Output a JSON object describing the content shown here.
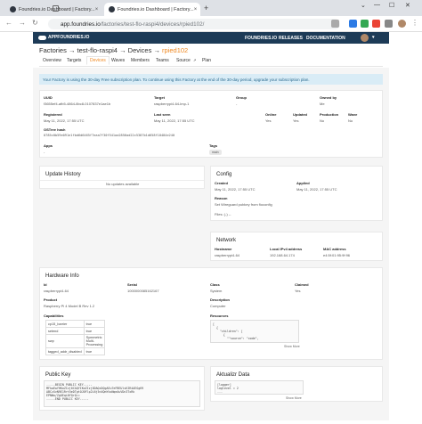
{
  "browser": {
    "tabs": [
      {
        "title": "Foundries.io Dashboard | Factory..."
      },
      {
        "title": "Foundries.io Dashboard | Factory..."
      }
    ],
    "url_host": "app.foundries.io",
    "url_path": "/factories/test-flo-raspi4/devices/rpied102/"
  },
  "app": {
    "logo": "APPFOUNDRIES.IO",
    "nav": [
      "FOUNDRIES.IO",
      "RELEASES",
      "DOCUMENTATION"
    ]
  },
  "breadcrumb": {
    "factories": "Factories",
    "factory": "test-flo-raspi4",
    "devices": "Devices",
    "device": "rpied102",
    "arrow": "→"
  },
  "subtabs": [
    "Overview",
    "Targets",
    "Devices",
    "Waves",
    "Members",
    "Teams",
    "Source",
    "Plan"
  ],
  "alert": "Your Factory is using the 30-day Free subscription plan. To continue using this Factory at the end of the 30-day period, upgrade your subscription plan.",
  "device": {
    "uuid_label": "UUID",
    "uuid": "f3655ef4-afb5-4864-8bc8-0107837e1ae1b",
    "target_label": "Target",
    "target": "raspberrypi4-64-lmp-1",
    "group_label": "Group",
    "group": "-",
    "owned_label": "Owned by",
    "owned": "Me",
    "registered_label": "Registered",
    "registered": "May 11, 2022, 17:55 UTC",
    "lastseen_label": "Last seen",
    "lastseen": "May 11, 2022, 17:55 UTC",
    "online_label": "Online",
    "online": "Yes",
    "updated_label": "Updated",
    "updated": "Yes",
    "production_label": "Production",
    "production": "No",
    "wave_label": "Wave",
    "wave": "No",
    "ostree_label": "OSTree hash",
    "ostree": "0785c0b59e091e1fbd6d6465f7eaa7f30f541aa2856ad22c5387b1d658f18484e240",
    "apps_label": "Apps",
    "apps": "-",
    "tags_label": "Tags",
    "tag": "main"
  },
  "update_history": {
    "title": "Update History",
    "empty": "No updates available"
  },
  "config": {
    "title": "Config",
    "created_label": "Created",
    "created": "May 11, 2022, 17:55 UTC",
    "applied_label": "Applied",
    "applied": "May 11, 2022, 17:55 UTC",
    "reason_label": "Reason",
    "reason": "Set Wireguard pubkey from fioconfig",
    "files_label": "Files: (-) --"
  },
  "network": {
    "title": "Network",
    "hostname_label": "Hostname",
    "hostname": "raspberrypi4-64",
    "ipv4_label": "Local IPv4 address",
    "ipv4": "192.168.64.174",
    "mac_label": "MAC address",
    "mac": "e4:5f:01:95:9f:96"
  },
  "hardware": {
    "title": "Hardware Info",
    "id_label": "Id",
    "id": "raspberrypi4-64",
    "serial_label": "Serial",
    "serial": "1000000085162167",
    "class_label": "Class",
    "class": "System",
    "claimed_label": "Claimed",
    "claimed": "Yes",
    "product_label": "Product",
    "product": "Raspberry Pi 4 Model B Rev 1.2",
    "desc_label": "Description",
    "desc": "Computer",
    "caps_label": "Capabilities",
    "capabilities": [
      [
        "cp15_barrier",
        "true"
      ],
      [
        "setend",
        "true"
      ],
      [
        "swp",
        "Symmetric Multi-Processing"
      ],
      [
        "tagged_addr_disabled",
        "true"
      ]
    ],
    "resources_label": "Resources",
    "resources_code": "[\n  {\n    \"children\": [\n      {\n        \"\"source\": \"code\",",
    "show_more": "Show More"
  },
  "public_key": {
    "title": "Public Key",
    "code": "-----BEGIN PUBLIC KEY-----\nMFkwEwYHKoZIzj0CAQYIKoZIzj0DAQcDQgAEu7eFBEUlsKIR4AEGgK9\nABCzXvN9E1Rrt5eDTgtOJ0Flp2L6j5nXQmYkxNqeAuVDn3TxRk\nEPNWo/ZgUEqi0YQrQ==\n-----END PUBLIC KEY-----"
  },
  "aktualizr": {
    "title": "Aktualizr Data",
    "code": "[logger]\nloglevel = 2\n...",
    "show_more": "Show More"
  },
  "colors": {
    "accent": "#f08a24",
    "nav": "#1d3b57",
    "alert_bg": "#d9ecf6"
  }
}
